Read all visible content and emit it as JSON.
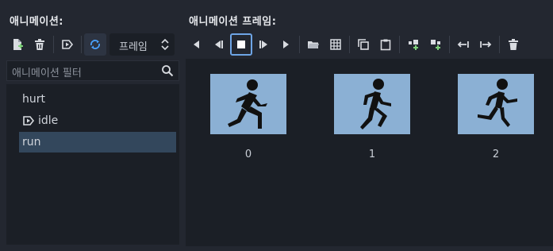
{
  "left_title": "애니메이션:",
  "right_title": "애니메이션 프레임:",
  "speed_label": "프레임",
  "search_placeholder": "애니메이션 필터",
  "animations": [
    {
      "label": "hurt",
      "selected": false,
      "autoplay": false
    },
    {
      "label": "idle",
      "selected": false,
      "autoplay": true
    },
    {
      "label": "run",
      "selected": true,
      "autoplay": false
    }
  ],
  "frames": [
    "0",
    "1",
    "2"
  ],
  "colors": {
    "accent": "#6ea5e6",
    "add_green": "#7ed17a",
    "frame_bg": "#8bb0d4",
    "selection": "#33475c"
  },
  "icons_left": [
    "new-animation-icon",
    "delete-animation-icon",
    "autoplay-icon",
    "loop-icon"
  ],
  "icons_right": [
    "play-backwards-icon",
    "play-backwards-from-end-icon",
    "stop-icon",
    "play-from-start-icon",
    "play-icon",
    "open-file-icon",
    "sprite-sheet-icon",
    "copy-icon",
    "paste-icon",
    "insert-before-icon",
    "insert-after-icon",
    "move-left-icon",
    "move-right-icon",
    "delete-frame-icon"
  ]
}
